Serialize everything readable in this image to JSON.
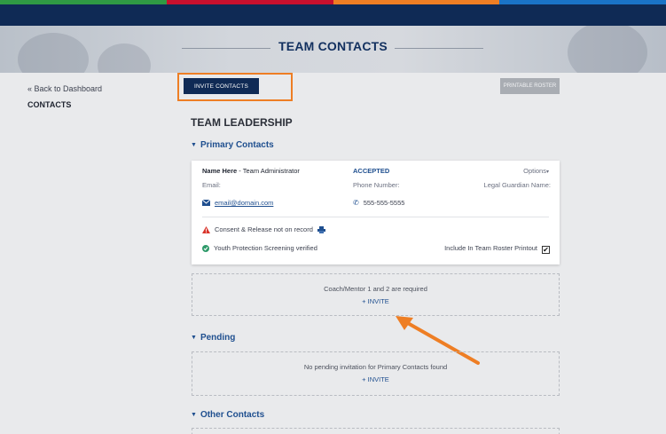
{
  "colors": {
    "strip": [
      "#2f9a44",
      "#c8102e",
      "#ee7e24",
      "#1a73c7"
    ],
    "navy": "#0f2a55",
    "accent_link": "#1f4f8f",
    "highlight_orange": "#ee7e24"
  },
  "hero": {
    "title": "TEAM CONTACTS"
  },
  "nav": {
    "back_label": "« Back to Dashboard",
    "current_label": "CONTACTS"
  },
  "toolbar": {
    "invite_label": "INVITE CONTACTS",
    "print_label": "PRINTABLE ROSTER"
  },
  "section": {
    "title": "TEAM LEADERSHIP"
  },
  "primary": {
    "title": "Primary Contacts",
    "card": {
      "name": "Name Here",
      "role": " - Team Administrator",
      "status": "ACCEPTED",
      "options_label": "Options",
      "email_label": "Email:",
      "phone_label": "Phone Number:",
      "guardian_label": "Legal Guardian Name:",
      "email_value": "email@domain.com",
      "phone_value": "555-555-5555",
      "consent_text": "Consent & Release not on record",
      "screening_text": "Youth Protection Screening verified",
      "include_label": "Include In Team Roster Printout",
      "include_checked": true,
      "icons": [
        "email-icon",
        "phone-icon",
        "warning-icon",
        "print-icon",
        "check-circle-icon"
      ]
    },
    "required_msg": "Coach/Mentor 1 and 2 are required",
    "invite_label": "+ INVITE"
  },
  "pending": {
    "title": "Pending",
    "empty_msg": "No pending invitation for Primary Contacts found",
    "invite_label": "+ INVITE"
  },
  "other": {
    "title": "Other Contacts"
  }
}
